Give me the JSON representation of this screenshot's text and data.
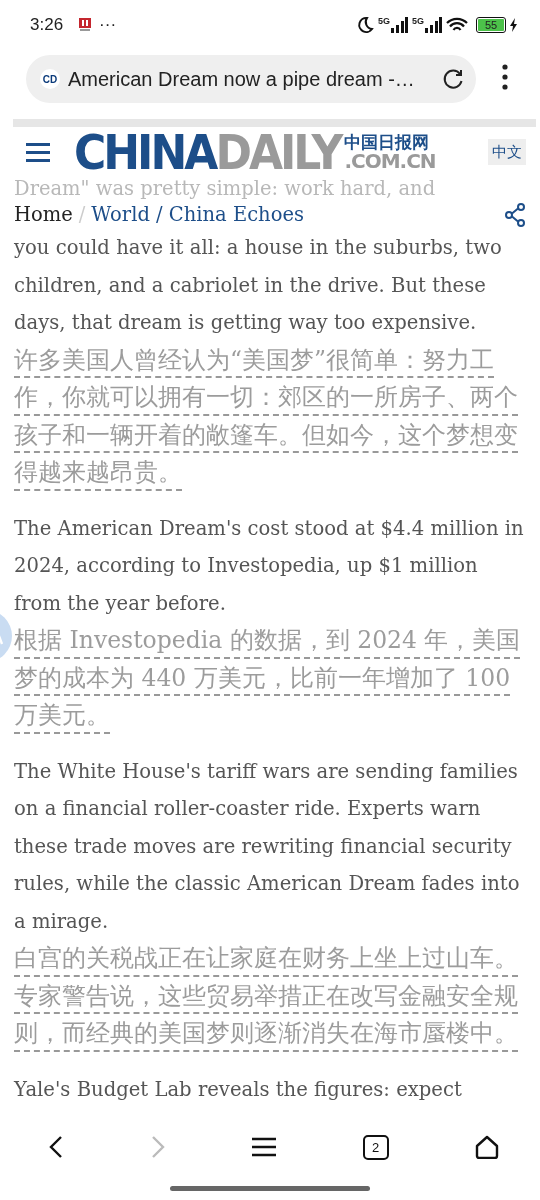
{
  "status_bar": {
    "time": "3:26",
    "more": "···",
    "network_1": "5G",
    "network_2": "5G",
    "battery": "55"
  },
  "address_bar": {
    "site_badge": "CD",
    "title": "American Dream now a pipe dream -…"
  },
  "site_header": {
    "logo": {
      "part_1": "CHINA",
      "part_2": "DAILY",
      "chinese": "中国日报网",
      "domain": ".COM.CN"
    },
    "language_button": "中文",
    "faded_text": "Dream\" was pretty simple: work hard, and"
  },
  "breadcrumb": [
    {
      "label": "Home",
      "kind": "plain"
    },
    {
      "label": "/",
      "kind": "separator"
    },
    {
      "label": "World / China Echoes",
      "kind": "link"
    }
  ],
  "article": [
    {
      "english": "you could have it all: a house in the suburbs, two children, and a cabriolet in the drive. But these days, that dream is getting way too expensive.",
      "chinese": "许多美国人曾经认为“美国梦”很简单：努力工作，你就可以拥有一切：郊区的一所房子、两个孩子和一辆开着的敞篷车。但如今，这个梦想变得越来越昂贵。"
    },
    {
      "english": "The American Dream's cost stood at $4.4 million in 2024, according to Investopedia, up $1 million from the year before.",
      "chinese": "根据 Investopedia 的数据，到 2024 年，美国梦的成本为 440 万美元，比前一年增加了 100 万美元。"
    },
    {
      "english": "The White House's tariff wars are sending families on a financial roller-coaster ride. Experts warn these trade moves are rewriting financial security rules, while the classic American Dream fades into a mirage.",
      "chinese": "白宫的关税战正在让家庭在财务上坐上过山车。专家警告说，这些贸易举措正在改写金融安全规则，而经典的美国梦则逐渐消失在海市蜃楼中。"
    },
    {
      "english": "Yale's Budget Lab reveals the figures: expect"
    }
  ],
  "bottom_nav": [
    {
      "kind": "back",
      "disabled": false
    },
    {
      "kind": "forward",
      "disabled": true
    },
    {
      "kind": "menu",
      "disabled": false
    },
    {
      "kind": "tabs",
      "disabled": false,
      "count": "2"
    },
    {
      "kind": "home",
      "disabled": false
    }
  ]
}
